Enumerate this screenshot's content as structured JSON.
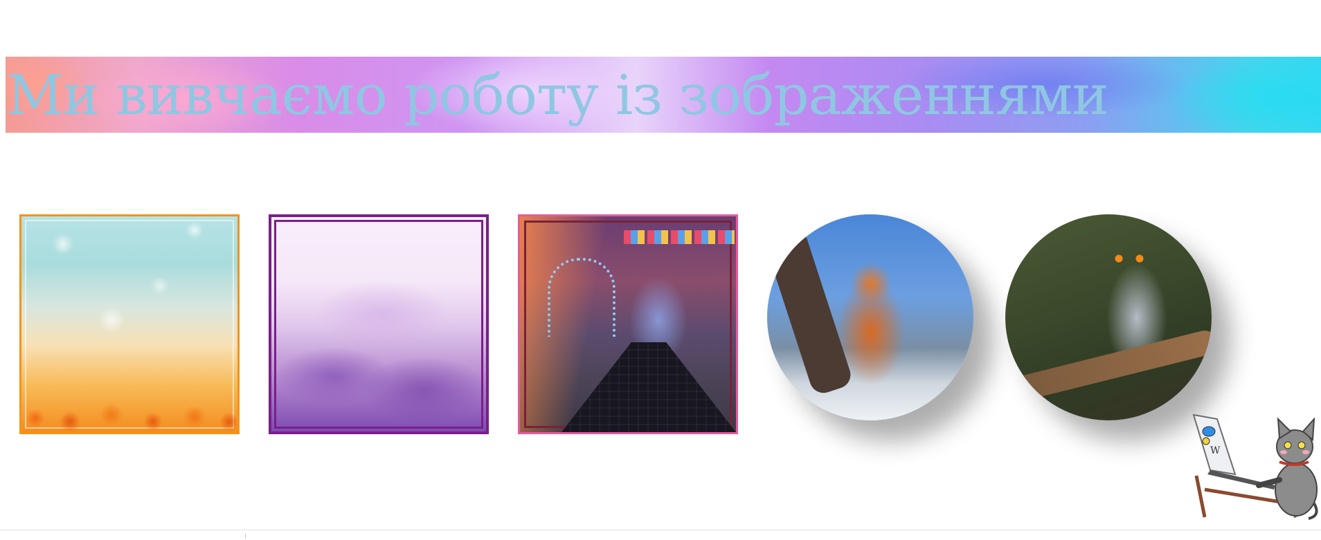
{
  "header": {
    "title": "Ми вивчаємо роботу із зображеннями"
  },
  "gallery": {
    "images": [
      {
        "name": "autumn-frame",
        "shape": "square",
        "border_color": "#f39418"
      },
      {
        "name": "purple-mist-frame",
        "shape": "square",
        "border_color": "#7a1f8a"
      },
      {
        "name": "night-street-frame",
        "shape": "square",
        "border_color": "#e45b9d"
      },
      {
        "name": "fox-photo",
        "shape": "circle"
      },
      {
        "name": "owl-photo",
        "shape": "circle"
      }
    ]
  },
  "mascot": {
    "laptop_logo": "W"
  },
  "colors": {
    "title_text": "#8fc7e2",
    "banner_start": "#f59a94",
    "banner_end": "#34d8f0"
  }
}
